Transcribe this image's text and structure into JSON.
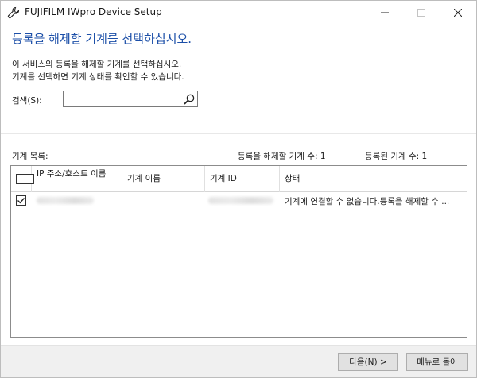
{
  "window": {
    "title": "FUJIFILM IWpro Device Setup",
    "app_icon": "wrench-icon",
    "minimize_icon": "minimize-icon",
    "maximize_icon": "maximize-icon",
    "close_icon": "close-icon"
  },
  "header": {
    "heading": "등록을 해제할 기계를 선택하십시오.",
    "description_line1": "이 서비스의 등록을 해제할 기계를 선택하십시오.",
    "description_line2": "기계를 선택하면 기계 상태를 확인할 수 있습니다."
  },
  "search": {
    "label": "검색(S):",
    "value": "",
    "placeholder": "",
    "icon": "search-icon"
  },
  "list": {
    "label": "기계 목록:",
    "count_to_remove": "등록을 해제할 기계 수:  1",
    "count_registered": "등록된 기계 수: 1",
    "columns": {
      "ip": "IP 주소/호스트 이름",
      "name": "기계 이름",
      "id": "기계 ID",
      "status": "상태"
    },
    "rows": [
      {
        "checked": true,
        "ip": "",
        "name": "",
        "id": "",
        "status": "기계에 연결할 수 없습니다.등록을 해제할 수 ..."
      }
    ]
  },
  "footer": {
    "next_label": "다음(N) >",
    "menu_label": "메뉴로 돌아"
  },
  "colors": {
    "heading": "#1c4fa8",
    "footer_bg": "#f0f0f0",
    "button_bg": "#e1e1e1"
  }
}
